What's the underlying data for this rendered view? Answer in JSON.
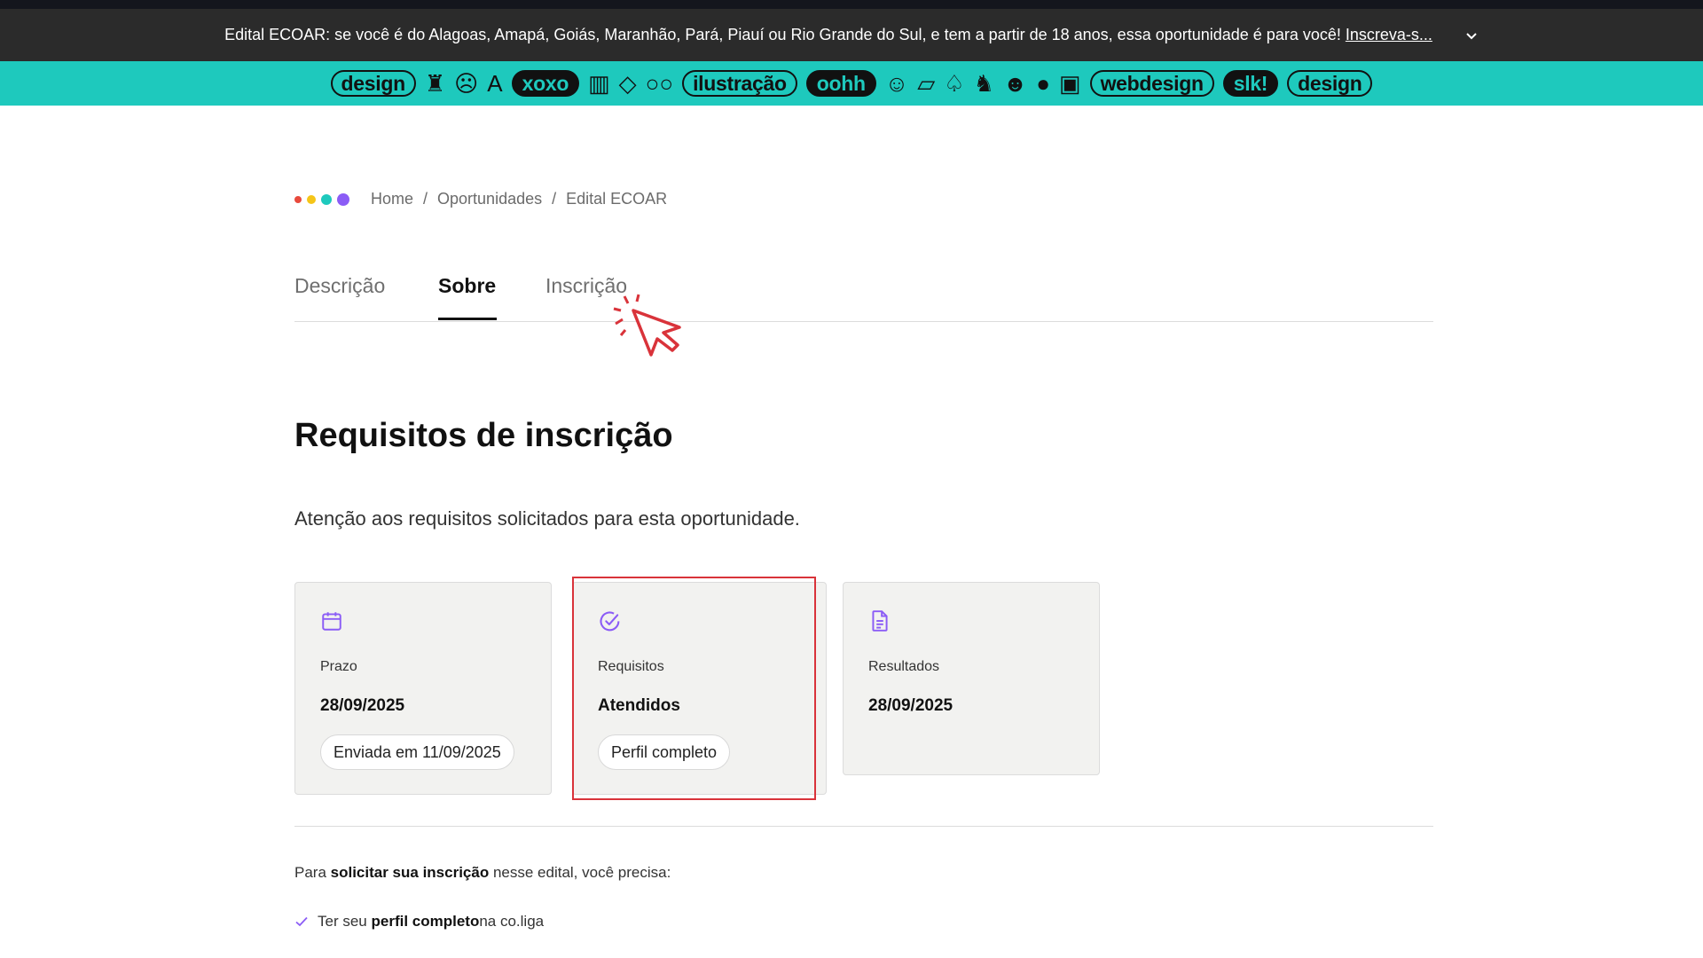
{
  "banner": {
    "text": "Edital ECOAR: se você é do Alagoas, Amapá, Goiás, Maranhão, Pará, Piauí ou Rio Grande do Sul, e tem a partir de 18 anos, essa oportunidade é para você! ",
    "link": "Inscreva-s...",
    "expand_icon": "chevron-down-icon"
  },
  "tagbar": {
    "items": [
      {
        "kind": "pill",
        "text": "design"
      },
      {
        "kind": "glyph",
        "icon": "cat-icon",
        "glyph": "♜"
      },
      {
        "kind": "glyph",
        "icon": "dizzy-face-icon",
        "glyph": "☹"
      },
      {
        "kind": "glyph",
        "icon": "letter-a-icon",
        "glyph": "A"
      },
      {
        "kind": "pill-dark",
        "text": "xoxo"
      },
      {
        "kind": "glyph",
        "icon": "books-icon",
        "glyph": "▥"
      },
      {
        "kind": "glyph",
        "icon": "diamond-icon",
        "glyph": "◇"
      },
      {
        "kind": "glyph",
        "icon": "glasses-icon",
        "glyph": "○○"
      },
      {
        "kind": "pill",
        "text": "ilustração"
      },
      {
        "kind": "pill-dark",
        "text": "oohh"
      },
      {
        "kind": "glyph",
        "icon": "smile-icon",
        "glyph": "☺"
      },
      {
        "kind": "glyph",
        "icon": "folder-icon",
        "glyph": "▱"
      },
      {
        "kind": "glyph",
        "icon": "tree-icon",
        "glyph": "♤"
      },
      {
        "kind": "glyph",
        "icon": "black-cat-icon",
        "glyph": "♞"
      },
      {
        "kind": "glyph",
        "icon": "wink-face-icon",
        "glyph": "☻"
      },
      {
        "kind": "glyph",
        "icon": "lips-icon",
        "glyph": "●"
      },
      {
        "kind": "glyph",
        "icon": "monitor-icon",
        "glyph": "▣"
      },
      {
        "kind": "pill",
        "text": "webdesign"
      },
      {
        "kind": "pill-dark",
        "text": "slk!"
      },
      {
        "kind": "pill",
        "text": "design"
      }
    ]
  },
  "breadcrumb": {
    "dot_colors": [
      "#e84a3c",
      "#f5c518",
      "#1ec9bd",
      "#8b5cf6"
    ],
    "items": [
      "Home",
      "Oportunidades",
      "Edital ECOAR"
    ],
    "separator": "/"
  },
  "tabs": [
    {
      "label": "Descrição",
      "active": false
    },
    {
      "label": "Sobre",
      "active": true
    },
    {
      "label": "Inscrição",
      "active": false
    }
  ],
  "section": {
    "title": "Requisitos de inscrição",
    "intro": "Atenção aos requisitos solicitados para esta oportunidade."
  },
  "cards": [
    {
      "icon": "calendar-icon",
      "label": "Prazo",
      "value": "28/09/2025",
      "chip": "Enviada em 11/09/2025"
    },
    {
      "icon": "check-circle-icon",
      "label": "Requisitos",
      "value": "Atendidos",
      "chip": "Perfil completo"
    },
    {
      "icon": "document-icon",
      "label": "Resultados",
      "value": "28/09/2025"
    }
  ],
  "instructions": {
    "prefix": "Para ",
    "bold": "solicitar sua inscrição",
    "suffix": " nesse edital, você precisa:"
  },
  "requirement": {
    "icon": "check-icon",
    "prefix": "Ter seu ",
    "bold": "perfil completo",
    "suffix": " na co.liga"
  },
  "colors": {
    "accent_teal": "#1ec9bd",
    "icon_purple": "#8b5cf6",
    "highlight_red": "#d9333a",
    "banner_bg": "#2b2b2b"
  }
}
